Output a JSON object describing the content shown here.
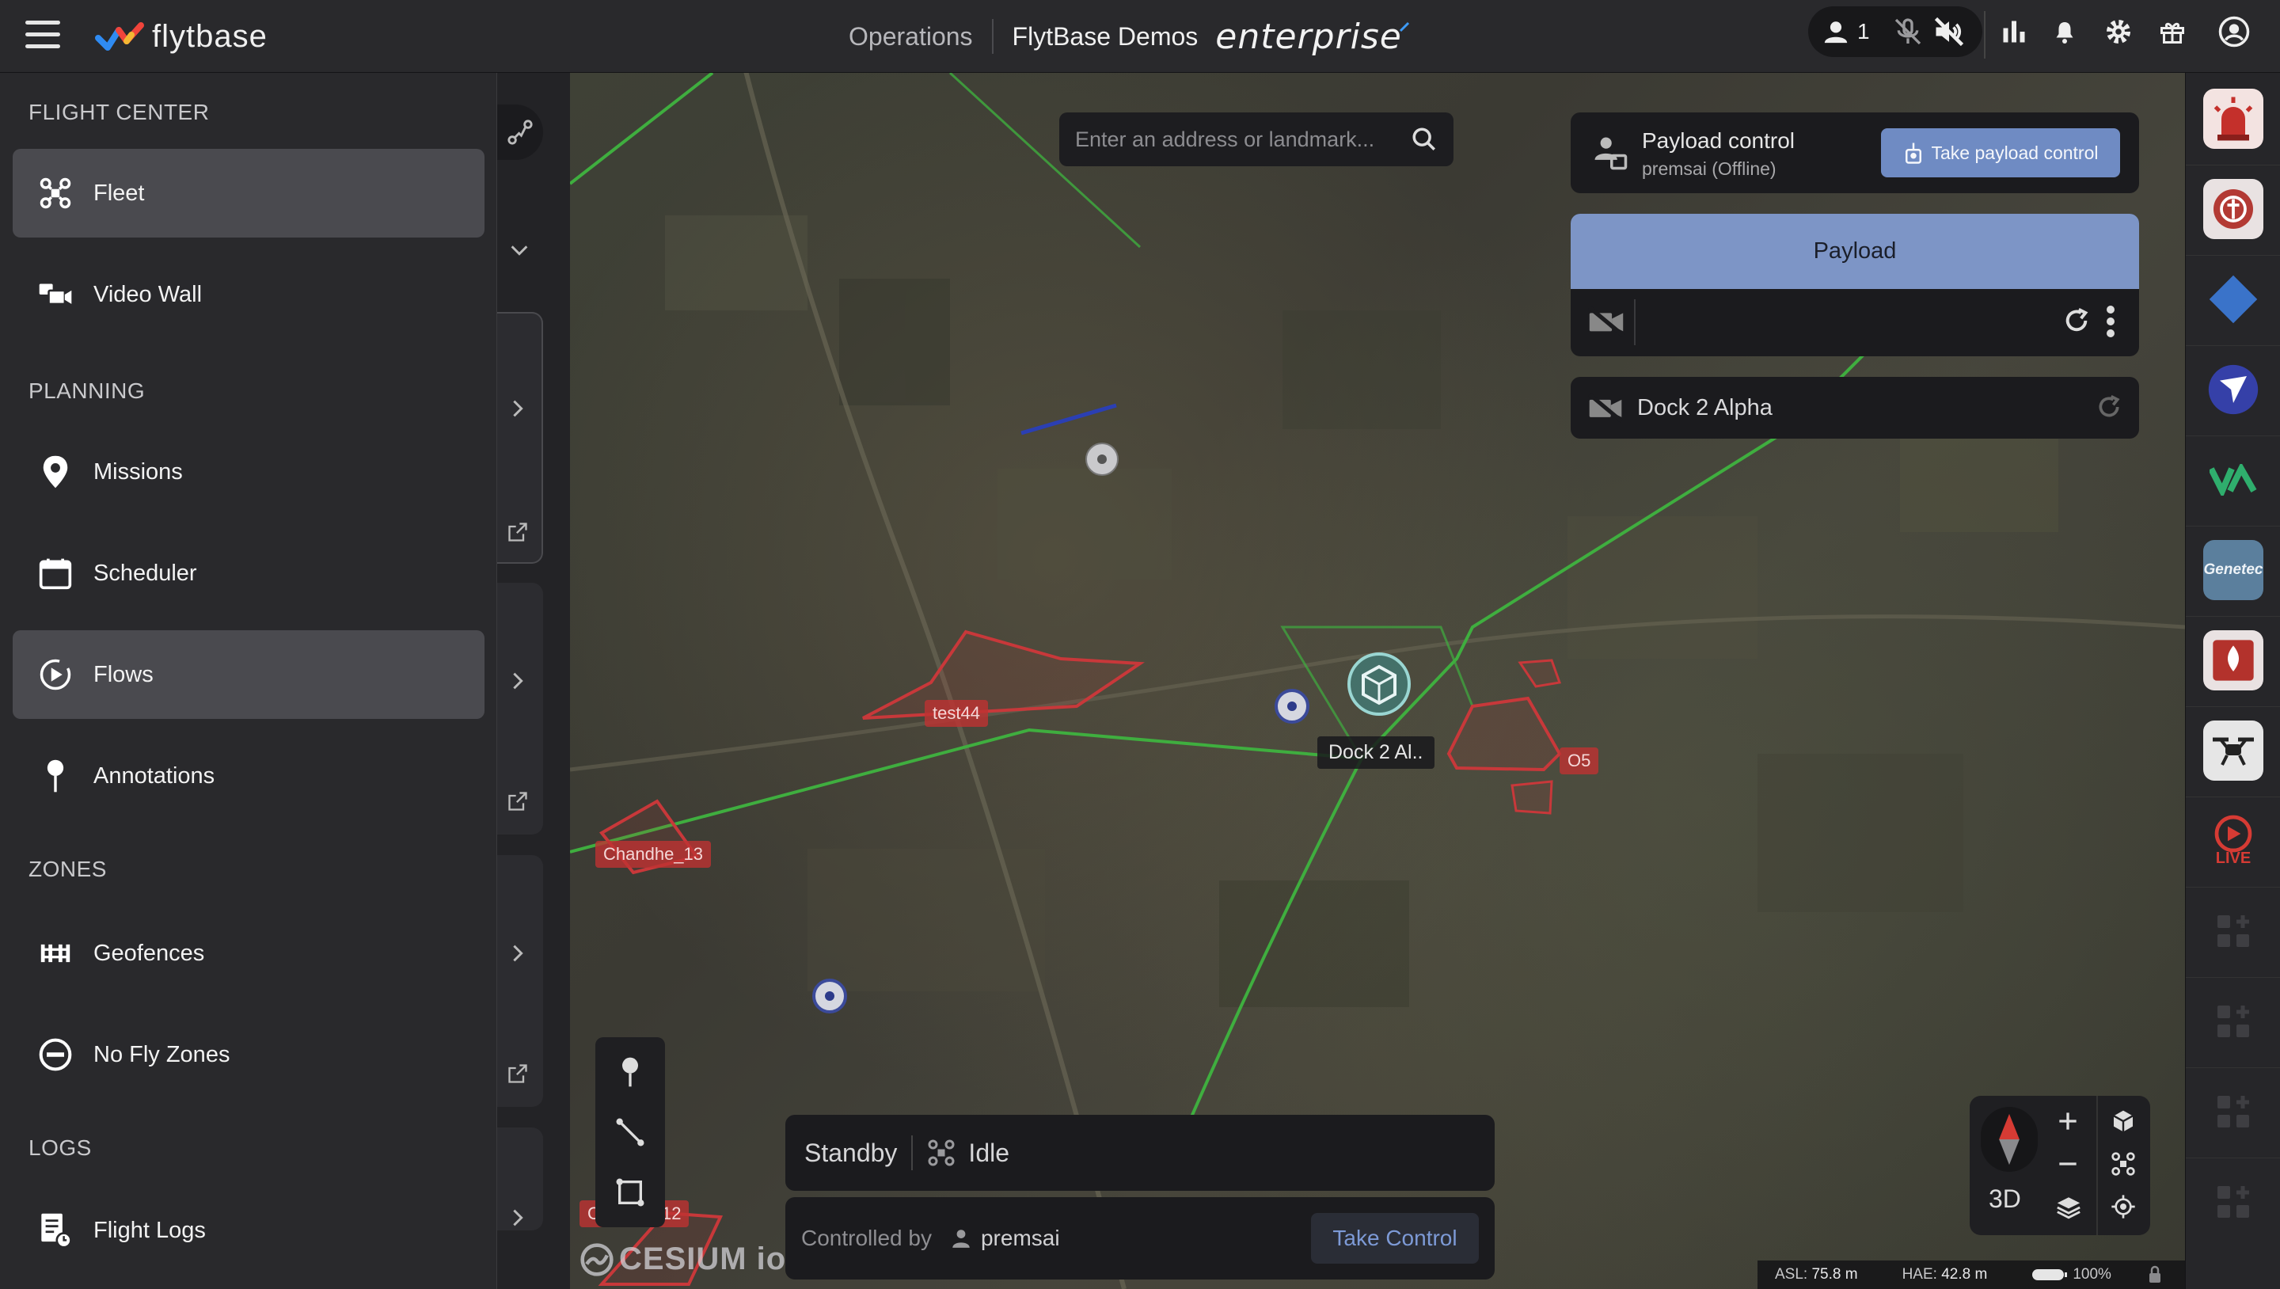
{
  "header": {
    "logo_text": "flytbase",
    "operations_label": "Operations",
    "org_name": "FlytBase Demos",
    "edition": "enterprise",
    "online_count": "1"
  },
  "sidebar": {
    "sections": [
      {
        "title": "FLIGHT CENTER"
      },
      {
        "title": "PLANNING"
      },
      {
        "title": "ZONES"
      },
      {
        "title": "LOGS"
      }
    ],
    "items": [
      {
        "label": "Fleet",
        "icon": "drone-icon",
        "active": true
      },
      {
        "label": "Video Wall",
        "icon": "video-wall-icon",
        "active": false
      },
      {
        "label": "Missions",
        "icon": "map-pin-icon",
        "active": false
      },
      {
        "label": "Scheduler",
        "icon": "calendar-icon",
        "active": false
      },
      {
        "label": "Flows",
        "icon": "flows-icon",
        "active": true
      },
      {
        "label": "Annotations",
        "icon": "annotation-pin-icon",
        "active": false
      },
      {
        "label": "Geofences",
        "icon": "geofence-icon",
        "active": false
      },
      {
        "label": "No Fly Zones",
        "icon": "no-entry-icon",
        "active": false
      },
      {
        "label": "Flight Logs",
        "icon": "flight-log-icon",
        "active": false
      }
    ]
  },
  "search": {
    "placeholder": "Enter an address or landmark..."
  },
  "payload_control": {
    "title": "Payload control",
    "owner": "premsai (Offline)",
    "take_button": "Take payload control"
  },
  "payload_panel": {
    "title": "Payload"
  },
  "dock_panel": {
    "label": "Dock 2 Alpha"
  },
  "map": {
    "labels": {
      "test": "test44",
      "chandhe": "Chandhe_13",
      "o5": "O5",
      "dock": "Dock 2 Al..",
      "bottom_left_a": "C",
      "bottom_left_b": "12"
    },
    "view_mode": "3D",
    "attribution": "CESIUM ion",
    "asl_label": "ASL:",
    "asl_value": "75.8 m",
    "hae_label": "HAE:",
    "hae_value": "42.8 m",
    "battery": "100%"
  },
  "status": {
    "state": "Standby",
    "drone_state": "Idle",
    "controlled_by_label": "Controlled by",
    "controller": "premsai",
    "take_control": "Take Control"
  },
  "rail": {
    "live_label": "LIVE",
    "genetec_label": "Genetec"
  },
  "colors": {
    "accent": "#7d95c6",
    "button_blue": "#6f8bc3",
    "zone_red": "#c8383a",
    "path_green": "#3fae3f"
  }
}
